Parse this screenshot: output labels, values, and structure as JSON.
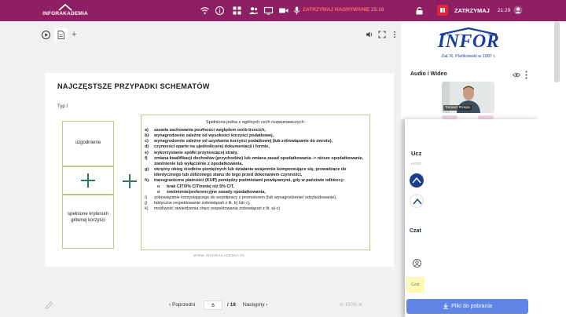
{
  "topbar": {
    "brand": "INFORAKADEMIA",
    "recording": "ZATRZYMAJ NAGRYWANIE",
    "recording_time": "25:19",
    "stop_label": "ZATRZYMAJ",
    "clock": "21:29",
    "bg_color": "#8f1f63"
  },
  "slide": {
    "title": "NAJCZĘSTSZE PRZYPADKI SCHEMATÓW",
    "type_label": "Typ I",
    "box_agreement": "uzgodnienie",
    "box_main_benefit": "spełnione kryterium głównej korzyści",
    "main_heading": "Spełniona jedna z ogólnych cech rozpoznawczych:",
    "criteria": [
      {
        "letter": "a)",
        "text": "zasada zachowania poufności względem osób trzecich,",
        "bold": true
      },
      {
        "letter": "b)",
        "text": "wynagrodzenie zależne od wysokości korzyści podatkowej,",
        "bold": true
      },
      {
        "letter": "c)",
        "text": "wynagrodzenie zależne od uzyskania korzyści podatkowej (lub zobowiązanie do zwrotu),",
        "bold": true
      },
      {
        "letter": "d)",
        "text": "czynności oparte na ujednoliconej dokumentacji i formie,",
        "bold": true
      },
      {
        "letter": "e)",
        "text": "wykorzystanie spółki przynoszącej straty,",
        "bold": true
      },
      {
        "letter": "f)",
        "text": "zmiana kwalifikacji dochodów (przychodów) lub zmiana zasad opodatkowania -> niższe opodatkowanie, zwolnienie lub wyłączenie z opodatkowania,",
        "bold": true
      },
      {
        "letter": "g)",
        "text": "okrężny obieg środków pieniężnych lub działania wzajemnie kompensujące się, prowadzące do identycznego lub zbliżonego stanu do tego przed dokonaniem czynności,",
        "bold": true
      },
      {
        "letter": "h)",
        "text": "transgraniczne płatności (KUP) pomiędzy podmiotami powiązanymi, gdy w państwie odbiorcy:",
        "bold": true
      },
      {
        "letter": "o",
        "text": "brak CIT/0% CIT/mniej niż 5% CIT,",
        "bold": true,
        "sub": true
      },
      {
        "letter": "o",
        "text": "zwolnienie/preferencyjne zasady opodatkowania,",
        "bold": true,
        "sub": true
      },
      {
        "letter": "i)",
        "text": "zobowiązanie korzystającego do współpracy z promotorem (lub wynagrodzenie/ odszkodowanie),",
        "bold": false
      },
      {
        "letter": "j)",
        "text": "faktyczne respektowanie zobowiązań z lit. b) lub c),",
        "bold": false
      },
      {
        "letter": "k)",
        "text": "możliwość stwierdzenia chęci respektowania zobowiązań z lit. a)-c)",
        "bold": false
      }
    ],
    "footer": "WWW.INFORAKADEMIA.PL"
  },
  "pager": {
    "prev": "Poprzedni",
    "current": "6",
    "total": "/ 18",
    "next": "Następny",
    "zoom": "100%"
  },
  "panel": {
    "brand": "INFOR",
    "brand_sub": "Zał. R. Pieńkowski w 1987 r.",
    "audio_video": "Audio i Wideo",
    "presenter": "Tomasz Rzepa",
    "participants": "Ucz",
    "hosts": "HOST",
    "chat": "Czat",
    "note": "Czat",
    "download": "Pliki do pobrania"
  }
}
